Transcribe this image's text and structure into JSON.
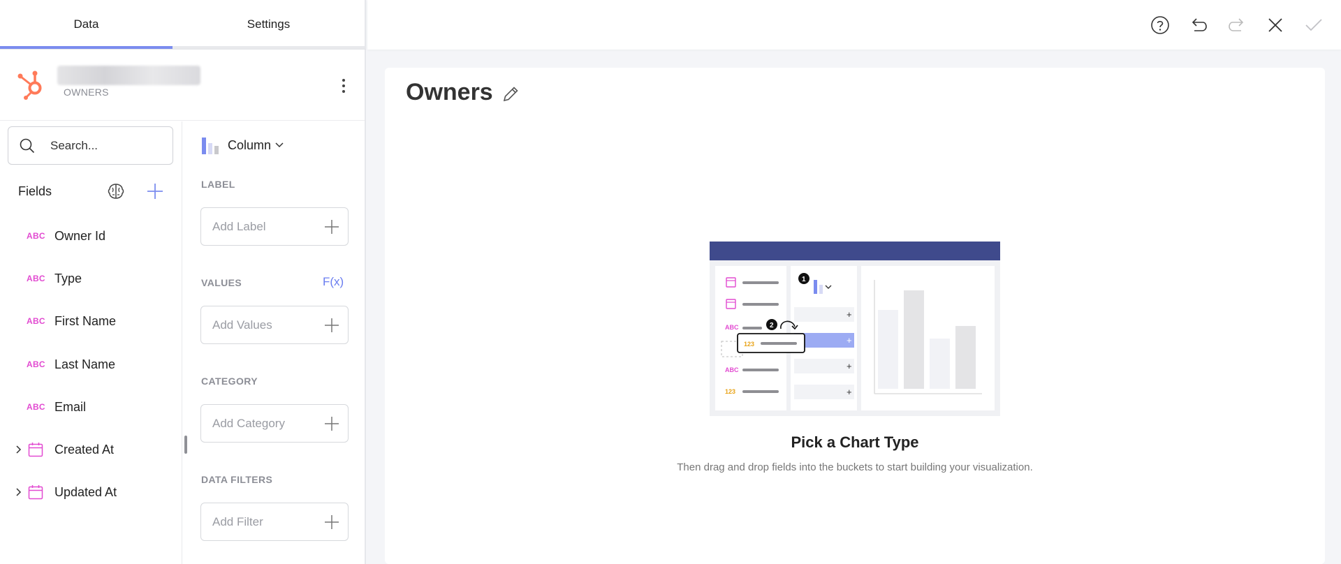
{
  "tabs": {
    "data": "Data",
    "settings": "Settings"
  },
  "source": {
    "subtitle": "OWNERS"
  },
  "search": {
    "placeholder": "Search..."
  },
  "fields": {
    "header": "Fields",
    "items": [
      {
        "type": "ABC",
        "name": "Owner Id"
      },
      {
        "type": "ABC",
        "name": "Type"
      },
      {
        "type": "ABC",
        "name": "First Name"
      },
      {
        "type": "ABC",
        "name": "Last Name"
      },
      {
        "type": "ABC",
        "name": "Email"
      },
      {
        "type": "date",
        "name": "Created At"
      },
      {
        "type": "date",
        "name": "Updated At"
      }
    ]
  },
  "settings": {
    "chart_type": "Column",
    "label_section": "LABEL",
    "label_bucket": "Add Label",
    "values_section": "VALUES",
    "fx": "F(x)",
    "values_bucket": "Add Values",
    "category_section": "CATEGORY",
    "category_bucket": "Add Category",
    "filters_section": "DATA FILTERS",
    "filters_bucket": "Add Filter"
  },
  "canvas": {
    "title": "Owners",
    "empty_title": "Pick a Chart Type",
    "empty_subtitle": "Then drag and drop fields into the buckets to start building your visualization."
  },
  "illustration": {
    "step1": "1",
    "step2": "2",
    "abc": "ABC",
    "num": "123",
    "plus": "+"
  },
  "colors": {
    "accent": "#7b8cef",
    "text_field_type": "#e24bd1",
    "date_field_icon": "#e24bd1",
    "hubspot": "#ff7a59",
    "illustration_header": "#3f4a8c"
  },
  "icons": {
    "topbar": [
      "help-icon",
      "undo-icon",
      "redo-icon",
      "close-icon",
      "check-icon"
    ]
  }
}
